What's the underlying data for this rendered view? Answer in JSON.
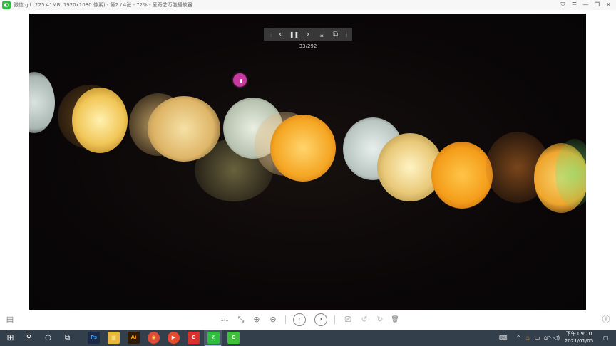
{
  "window": {
    "title": "微信.gif (225.41MB, 1920x1080 像素) - 第2 / 4张 - 72% - 爱奇艺万能播放器",
    "app_icon_glyph": "◐",
    "controls": {
      "pin": "⛉",
      "menu": "☰",
      "minimize": "—",
      "restore": "❐",
      "close": "✕"
    }
  },
  "viewer": {
    "frame_counter": "33/292",
    "float_toolbar": {
      "prev": "‹",
      "pause": "❚❚",
      "next": "›",
      "download": "⤓",
      "copy": "⧉",
      "grip": "⋮"
    }
  },
  "bottom_toolbar": {
    "gallery": "▤",
    "actual_size": "1:1",
    "fit": "⤡",
    "zoom_in": "⊕",
    "zoom_out": "⊖",
    "prev": "‹",
    "next": "›",
    "slideshow": "⎚",
    "rotate_left": "↺",
    "rotate_right": "↻",
    "delete": "🗑",
    "info": "ⓘ"
  },
  "taskbar": {
    "start": "⊞",
    "search": "⚲",
    "cortana": "○",
    "task_view": "⧉",
    "apps": [
      {
        "name": "photoshop",
        "label": "Ps",
        "color": "#1b2a48",
        "text": "#31a8ff"
      },
      {
        "name": "file-explorer",
        "label": "▆",
        "color": "#e8b93c",
        "text": "#f6d77a"
      },
      {
        "name": "illustrator",
        "label": "Ai",
        "color": "#2e1a05",
        "text": "#ff9a00"
      },
      {
        "name": "chrome",
        "label": "◉",
        "color": "#dd4b39",
        "text": "#ffd84a"
      },
      {
        "name": "player-red",
        "label": "▶",
        "color": "#e84a2e",
        "text": "#ffffff"
      },
      {
        "name": "app-c-red",
        "label": "C",
        "color": "#d9322e",
        "text": "#ffffff"
      },
      {
        "name": "wechat-active",
        "label": "✆",
        "color": "#2ebd3e",
        "text": "#ffffff"
      },
      {
        "name": "app-c-green",
        "label": "C",
        "color": "#3fbf3a",
        "text": "#ffffff"
      }
    ],
    "tray": {
      "keyboard": "⌨",
      "chevron": "^",
      "icon1": "♨",
      "battery": "▭",
      "network": "⌂",
      "wifi": "◠",
      "volume": "◁)"
    },
    "time": "下午 09:10",
    "date": "2021/01/05",
    "notifications": "▢"
  }
}
